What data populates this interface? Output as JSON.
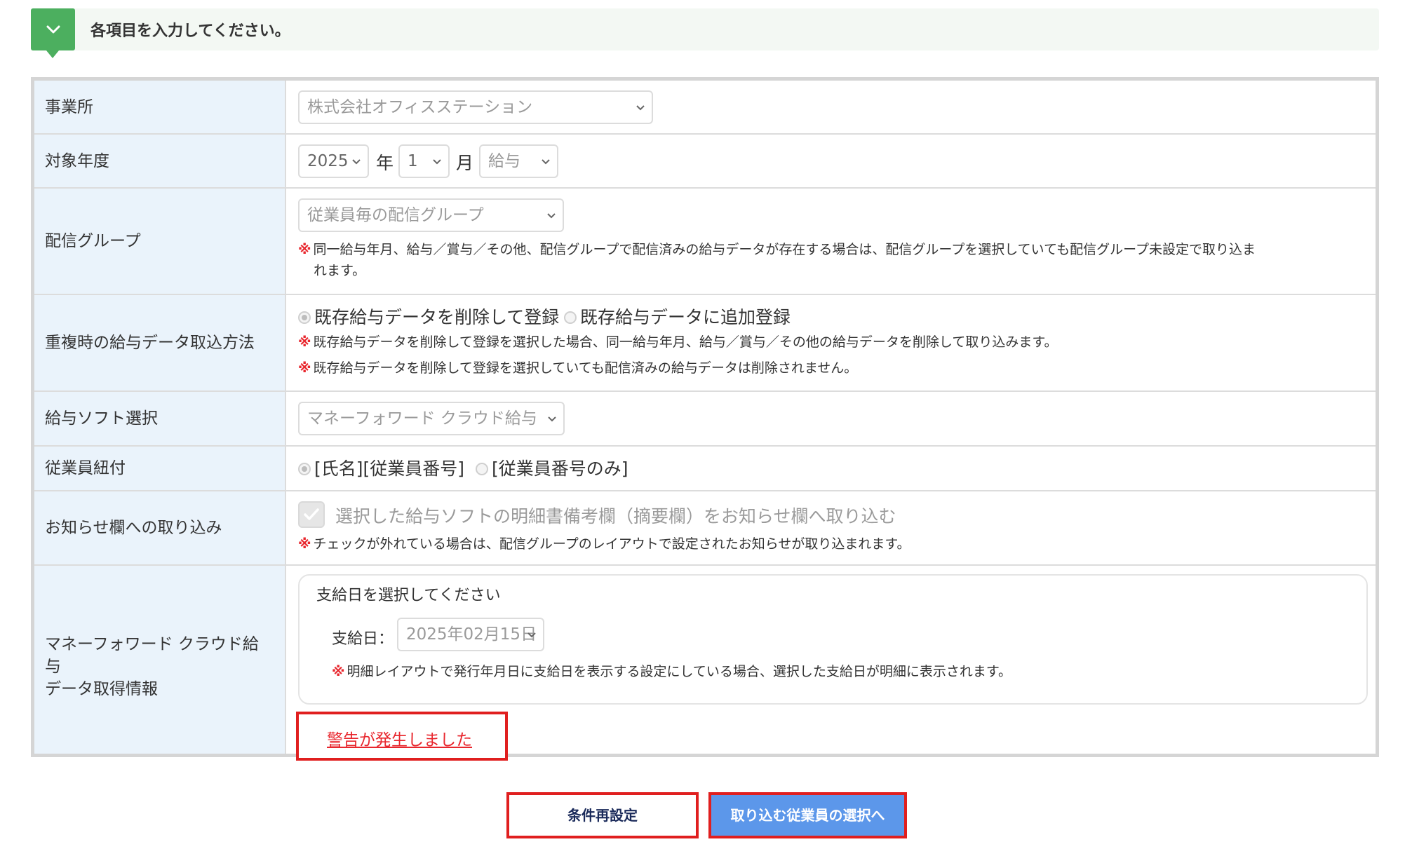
{
  "header": {
    "instruction": "各項目を入力してください。",
    "accent_color": "#4caf5f",
    "toggle_icon": "chevron-down-icon"
  },
  "form": {
    "office": {
      "label": "事業所",
      "value": "株式会社オフィスステーション"
    },
    "target_period": {
      "label": "対象年度",
      "year": "2025",
      "year_unit": "年",
      "month": "1",
      "month_unit": "月",
      "type": "給与"
    },
    "delivery_group": {
      "label": "配信グループ",
      "value": "従業員毎の配信グループ",
      "note_mark": "※",
      "note_line1": "同一給与年月、給与／賞与／その他、配信グループで配信済みの給与データが存在する場合は、配信グループを選択していても配信グループ未設定で取り込ま",
      "note_line2": "れます。"
    },
    "duplicate_method": {
      "label": "重複時の給与データ取込方法",
      "option1": "既存給与データを削除して登録",
      "option2": "既存給与データに追加登録",
      "selected": "既存給与データを削除して登録",
      "note_mark": "※",
      "note1": "既存給与データを削除して登録を選択した場合、同一給与年月、給与／賞与／その他の給与データを削除して取り込みます。",
      "note2": "既存給与データを削除して登録を選択していても配信済みの給与データは削除されません。"
    },
    "payroll_software": {
      "label": "給与ソフト選択",
      "value": "マネーフォワード クラウド給与"
    },
    "employee_link": {
      "label": "従業員紐付",
      "option1": "[氏名][従業員番号]",
      "option2": "[従業員番号のみ]",
      "selected": "[氏名][従業員番号]"
    },
    "notice_import": {
      "label": "お知らせ欄への取り込み",
      "checkbox_label": "選択した給与ソフトの明細書備考欄（摘要欄）をお知らせ欄へ取り込む",
      "checked": true,
      "note_mark": "※",
      "note": "チェックが外れている場合は、配信グループのレイアウトで設定されたお知らせが取り込まれます。"
    },
    "mf_info": {
      "label_line1": "マネーフォワード クラウド給",
      "label_line2": "与",
      "label_line3": "データ取得情報",
      "panel_heading": "支給日を選択してください",
      "payday_label": "支給日：",
      "payday_value": "2025年02月15日",
      "note_mark": "※",
      "note": "明細レイアウトで発行年月日に支給日を表示する設定にしている場合、選択した支給日が明細に表示されます。",
      "warning_link": "警告が発生しました"
    }
  },
  "buttons": {
    "reset_label": "条件再設定",
    "next_label": "取り込む従業員の選択へ"
  },
  "colors": {
    "label_bg": "#eaf3fb",
    "note_mark": "#e8262d",
    "highlight_border": "#e01f1f",
    "primary_button": "#5c97ea"
  }
}
